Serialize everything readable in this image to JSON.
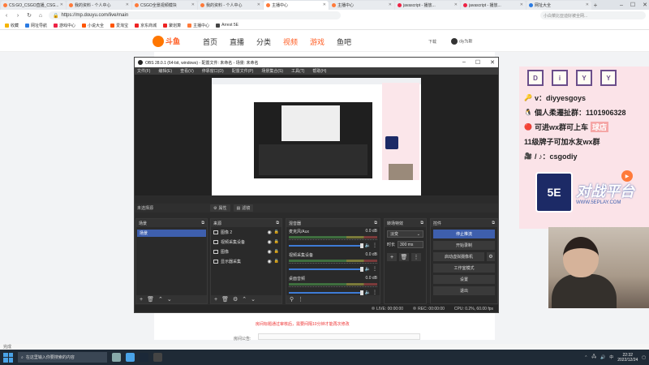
{
  "browser": {
    "tabs": [
      {
        "label": "CS:GO_CSGO直播_CSG...",
        "color": "#ff7a3a",
        "active": false
      },
      {
        "label": "我的资料 - 个人中心",
        "color": "#ff7a3a",
        "active": false
      },
      {
        "label": "CSGO全景视频模块",
        "color": "#ff7a3a",
        "active": false
      },
      {
        "label": "我的资料 - 个人中心",
        "color": "#ff7a3a",
        "active": false
      },
      {
        "label": "主播中心",
        "color": "#ff7a3a",
        "active": true
      },
      {
        "label": "主播中心",
        "color": "#ff7a3a",
        "active": false
      },
      {
        "label": "javascript - 播放...",
        "color": "#e24",
        "active": false
      },
      {
        "label": "javascript - 播放...",
        "color": "#e24",
        "active": false
      },
      {
        "label": "网址大全",
        "color": "#2a7ae2",
        "active": false
      }
    ],
    "url": "https://mp.douyu.com/live/main",
    "search_placeholder": "小白菜比亚迪好被全网...",
    "bookmarks": [
      {
        "label": "收藏",
        "color": "#f5b400"
      },
      {
        "label": "网址导航",
        "color": "#2a7ae2"
      },
      {
        "label": "游戏中心",
        "color": "#e24"
      },
      {
        "label": "小说大全",
        "color": "#f50"
      },
      {
        "label": "爱淘宝",
        "color": "#f50"
      },
      {
        "label": "京东商城",
        "color": "#e22"
      },
      {
        "label": "聚划算",
        "color": "#e22"
      },
      {
        "label": "主播中心",
        "color": "#ff7a3a"
      },
      {
        "label": "Arrest 5E",
        "color": "#444"
      }
    ],
    "status_text": "完成"
  },
  "site": {
    "logo_text": "斗鱼",
    "nav": [
      "首页",
      "直播",
      "分类",
      "视频",
      "游戏",
      "鱼吧"
    ],
    "download": "下载",
    "user": "diy为斯"
  },
  "page": {
    "notice": "房间标题通过审核后，需要间隔10分钟才能再次修改",
    "announce_label": "房间公告:"
  },
  "obs": {
    "title": "OBS 28.0.1 (64-bit, windows) - 配置文件: 未命名 - 场景: 未命名",
    "menu": [
      "文件(F)",
      "编辑(E)",
      "查看(V)",
      "停靠窗口(D)",
      "配置文件(P)",
      "场景集合(S)",
      "工具(T)",
      "帮助(H)"
    ],
    "no_source": "未选择源",
    "props_btn": "属性",
    "filters_btn": "滤镜",
    "docks": {
      "scenes": {
        "title": "场景",
        "items": [
          "场景"
        ]
      },
      "sources": {
        "title": "来源",
        "items": [
          "图像 2",
          "视频采集设备",
          "图像",
          "显示器采集"
        ]
      },
      "mixer": {
        "title": "混音器",
        "channels": [
          {
            "name": "麦克风/Aux",
            "db": "0.0 dB"
          },
          {
            "name": "视频采集设备",
            "db": "0.0 dB"
          },
          {
            "name": "桌面音频",
            "db": "0.0 dB"
          }
        ]
      },
      "transitions": {
        "title": "转场特效",
        "type": "淡变",
        "duration_label": "时长",
        "duration": "300 ms"
      },
      "controls": {
        "title": "控件",
        "buttons": [
          "停止推流",
          "开始录制",
          "启动虚拟摄像机",
          "工作室模式",
          "设置",
          "退出"
        ]
      }
    },
    "status": {
      "live": "LIVE: 00:00:00",
      "rec": "REC: 00:00:00",
      "cpu": "CPU: 0.2%, 60.00 fps"
    }
  },
  "overlay": {
    "letters": [
      "D",
      "i",
      "Y",
      "Y"
    ],
    "lines": [
      {
        "emoji": "🔑",
        "text": "v：diyyesgoys",
        "hl": ""
      },
      {
        "emoji": "🐧",
        "text": "個人柔遷扯群：1101906328",
        "hl": ""
      },
      {
        "emoji": "🔴",
        "text": "可进wx群可上车",
        "hl": "球店"
      },
      {
        "emoji": "",
        "text": "11级牌子可加水友wx群",
        "hl": ""
      },
      {
        "emoji": "🎥",
        "text": "/ ♪：csgodiy",
        "hl": ""
      }
    ],
    "badge": "5E",
    "brand": "对战平台",
    "url": "WWW.5EPLAY.COM"
  },
  "taskbar": {
    "search_placeholder": "在这里输入你要搜索的内容",
    "time": "22:32",
    "date": "2022/12/24",
    "lang": "中"
  }
}
